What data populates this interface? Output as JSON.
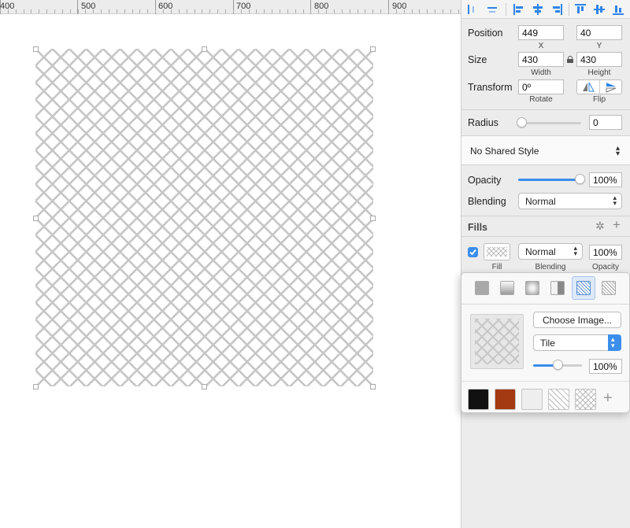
{
  "ruler": {
    "labels": [
      "400",
      "500",
      "600",
      "700",
      "800",
      "900"
    ]
  },
  "canvas": {
    "shape": {
      "pattern": "diagonal-crosshatch-tile",
      "line_color": "#c6c6c6"
    }
  },
  "alignment_toolbar": {
    "buttons": [
      "distribute-horizontally-icon",
      "distribute-vertically-icon",
      "align-left-icon",
      "align-center-horizontal-icon",
      "align-right-icon",
      "align-top-icon",
      "align-middle-vertical-icon",
      "align-bottom-icon"
    ]
  },
  "position": {
    "label": "Position",
    "x": "449",
    "y": "40",
    "x_label": "X",
    "y_label": "Y"
  },
  "size": {
    "label": "Size",
    "width": "430",
    "height": "430",
    "width_label": "Width",
    "height_label": "Height",
    "lock_icon": "lock-icon"
  },
  "transform": {
    "label": "Transform",
    "rotate": "0º",
    "rotate_label": "Rotate",
    "flip_label": "Flip"
  },
  "radius": {
    "label": "Radius",
    "value": "0",
    "slider_level": 0
  },
  "shared_style": {
    "value": "No Shared Style"
  },
  "opacity": {
    "label": "Opacity",
    "value": "100%",
    "slider_level": 1.0
  },
  "blending": {
    "label": "Blending",
    "value": "Normal"
  },
  "fills": {
    "label": "Fills",
    "enabled": true,
    "blend_value": "Normal",
    "opacity_value": "100%",
    "fill_label": "Fill",
    "blending_label": "Blending",
    "opacity_label": "Opacity"
  },
  "fill_popover": {
    "tabs": [
      "solid-fill-icon",
      "linear-gradient-icon",
      "radial-gradient-icon",
      "angular-gradient-icon",
      "pattern-fill-icon",
      "noise-fill-icon"
    ],
    "selected_tab": "pattern-fill-icon",
    "choose_image": "Choose Image...",
    "mode": "Tile",
    "scale": "100%",
    "scale_level": 0.5,
    "swatch_colors": [
      "#111111",
      "#a33a12",
      "#eeeeee"
    ],
    "add_icon": "+"
  },
  "colors": {
    "accent": "#3b8eea",
    "pattern_lines": "#c6c6c6"
  }
}
